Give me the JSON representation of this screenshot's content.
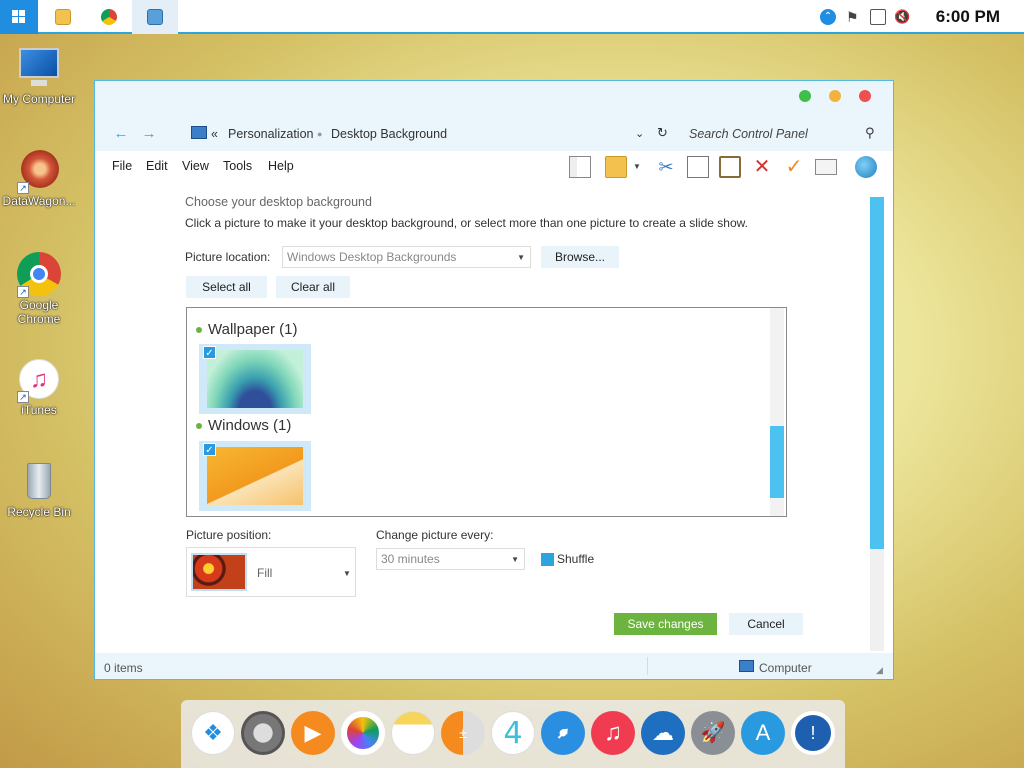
{
  "taskbar": {
    "clock": "6:00 PM",
    "apps": [
      {
        "name": "file-explorer"
      },
      {
        "name": "chrome"
      },
      {
        "name": "control-panel",
        "active": true
      }
    ]
  },
  "desktop": {
    "icons": [
      {
        "label": "My Computer",
        "icon": "monitor-icon"
      },
      {
        "label": "DataWagon...",
        "icon": "datawagon-icon"
      },
      {
        "label": "Google Chrome",
        "icon": "chrome-icon"
      },
      {
        "label": "iTunes",
        "icon": "itunes-icon"
      },
      {
        "label": "Recycle Bin",
        "icon": "recycle-bin-icon"
      }
    ]
  },
  "window": {
    "breadcrumb": {
      "prefix": "«",
      "items": [
        "Personalization",
        "Desktop Background"
      ]
    },
    "search_placeholder": "Search Control Panel",
    "menu": [
      "File",
      "Edit",
      "View",
      "Tools",
      "Help"
    ],
    "content": {
      "title": "Choose your desktop background",
      "instructions": "Click a picture to make it your desktop background, or select more than one picture to create a slide show.",
      "picture_location_label": "Picture location:",
      "picture_location_value": "Windows Desktop Backgrounds",
      "browse_label": "Browse...",
      "select_all_label": "Select all",
      "clear_all_label": "Clear all",
      "groups": [
        {
          "title": "Wallpaper (1)",
          "checked": true
        },
        {
          "title": "Windows (1)",
          "checked": true
        }
      ],
      "picture_position_label": "Picture position:",
      "picture_position_value": "Fill",
      "change_every_label": "Change picture every:",
      "change_every_value": "30 minutes",
      "shuffle_label": "Shuffle",
      "save_label": "Save changes",
      "cancel_label": "Cancel"
    },
    "status": {
      "items_count": "0 items",
      "location": "Computer"
    }
  },
  "dock": {
    "apps": [
      "dropbox",
      "settings",
      "media-player",
      "photos",
      "notes",
      "calculator",
      "app-4",
      "safari",
      "music",
      "onedrive",
      "launchpad",
      "app-store",
      "1password"
    ]
  },
  "colors": {
    "accent": "#2aa6dc",
    "save_button": "#6db33f",
    "group_dot": "#6cb33f"
  }
}
